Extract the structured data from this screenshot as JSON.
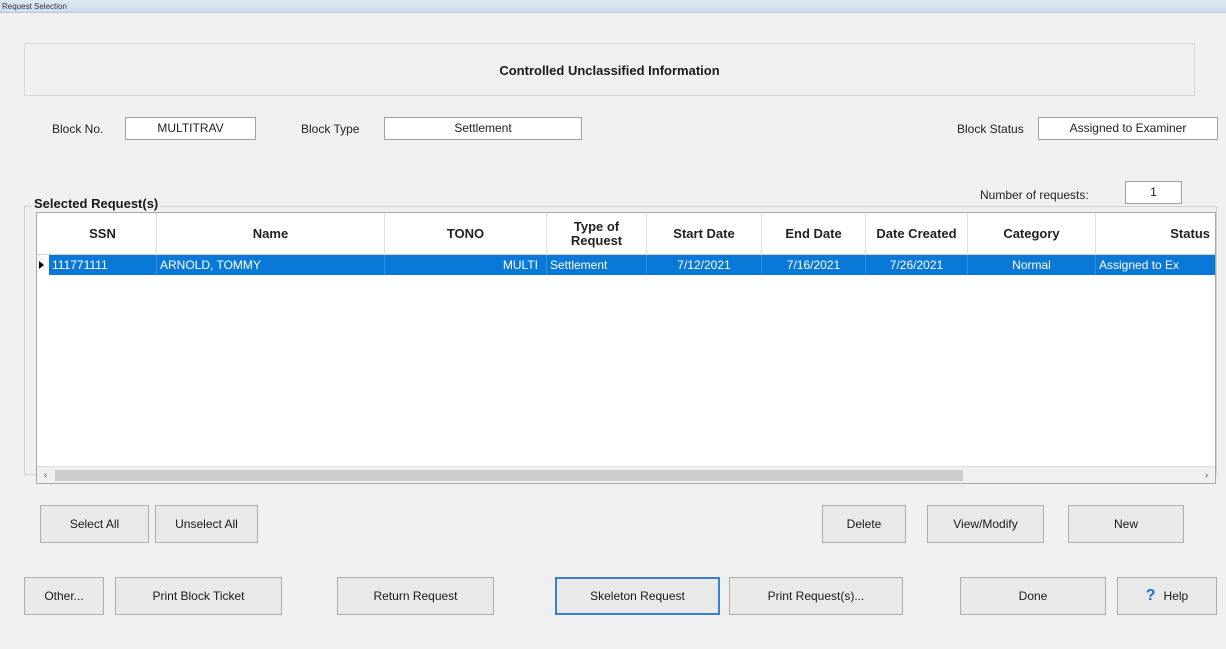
{
  "window": {
    "title": "Request Selection"
  },
  "banner": "Controlled Unclassified Information",
  "block": {
    "no_label": "Block No.",
    "no_value": "MULTITRAV",
    "type_label": "Block Type",
    "type_value": "Settlement",
    "status_label": "Block Status",
    "status_value": "Assigned to Examiner"
  },
  "selected": {
    "group_title": "Selected Request(s)",
    "count_label": "Number of requests:",
    "count_value": "1"
  },
  "table": {
    "columns": [
      "SSN",
      "Name",
      "TONO",
      "Type of Request",
      "Start Date",
      "End Date",
      "Date Created",
      "Category",
      "Status"
    ],
    "rows": [
      {
        "ssn": "111771111",
        "name": "ARNOLD, TOMMY",
        "tono": "MULTI",
        "type": "Settlement",
        "start": "7/12/2021",
        "end": "7/16/2021",
        "created": "7/26/2021",
        "category": "Normal",
        "status": "Assigned to Ex"
      }
    ]
  },
  "buttons": {
    "select_all": "Select All",
    "unselect_all": "Unselect All",
    "delete": "Delete",
    "view_modify": "View/Modify",
    "new": "New",
    "other": "Other...",
    "print_block_ticket": "Print Block Ticket",
    "return_request": "Return Request",
    "skeleton_request": "Skeleton Request",
    "print_requests": "Print Request(s)...",
    "done": "Done",
    "help": "Help"
  },
  "icons": {
    "help": "help-question-icon",
    "row_indicator": "row-pointer-icon"
  },
  "colors": {
    "selection": "#0a78d7",
    "help": "#1a6fd3"
  }
}
